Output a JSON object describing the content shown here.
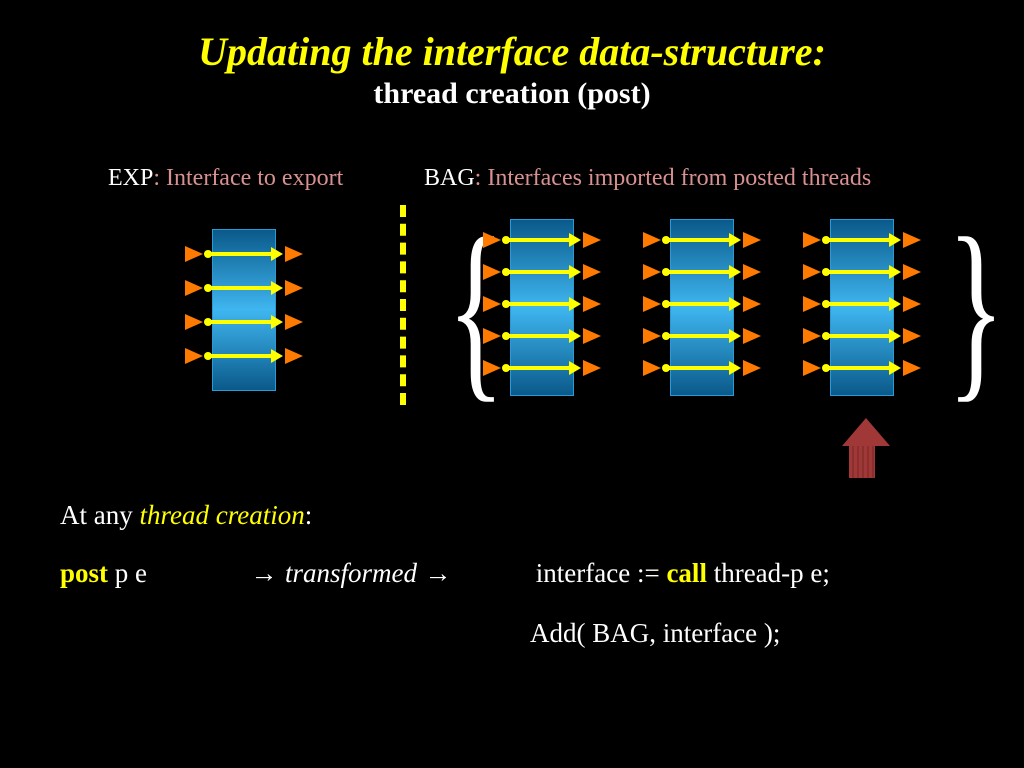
{
  "title": {
    "main": "Updating the interface data-structure:",
    "sub": "thread creation (post)"
  },
  "labels": {
    "exp_prefix": "EXP",
    "exp_desc": ": Interface to export",
    "bag_prefix": "BAG",
    "bag_desc": ": Interfaces imported from posted threads"
  },
  "text": {
    "line1_a": "At any ",
    "line1_b": "thread creation",
    "line1_c": ":",
    "line2_post": "post",
    "line2_pe": " p e",
    "line2_arrow1": " → ",
    "line2_transformed": "transformed",
    "line2_arrow2": " → ",
    "line2_iface": "interface := ",
    "line2_call": "call",
    "line2_tail": " thread-p e;",
    "line3": "Add( BAG,  interface );"
  },
  "diagram": {
    "exp_rows": 4,
    "bag_blocks": 3,
    "bag_rows": 5
  }
}
